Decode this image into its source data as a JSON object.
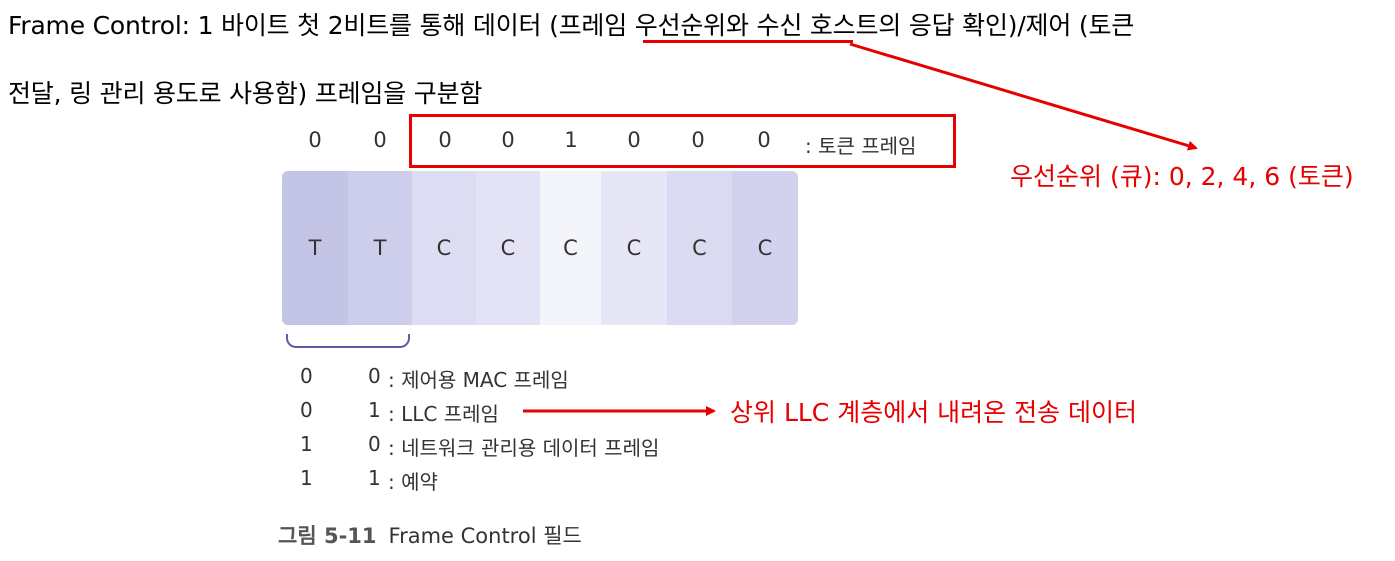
{
  "intro": {
    "line1_prefix": "Frame Control: 1 바이트 첫 2비트를 통해 데이터 (",
    "line1_highlight": "프레임 우선순위",
    "line1_suffix": "와 수신 호스트의 응답 확인)/제어 (토큰",
    "line2": "전달, 링 관리 용도로 사용함) 프레임을 구분함"
  },
  "bit_values": [
    "0",
    "0",
    "0",
    "0",
    "1",
    "0",
    "0",
    "0"
  ],
  "bits_suffix": ": 토큰 프레임",
  "priority_label": "우선순위 (큐): 0, 2, 4, 6 (토큰)",
  "fields": [
    {
      "label": "T",
      "color": "#c4c4e6"
    },
    {
      "label": "T",
      "color": "#cdcdec"
    },
    {
      "label": "C",
      "color": "#dcdcf2"
    },
    {
      "label": "C",
      "color": "#e3e3f5"
    },
    {
      "label": "C",
      "color": "#f4f4fb"
    },
    {
      "label": "C",
      "color": "#e6e6f6"
    },
    {
      "label": "C",
      "color": "#dadaf1"
    },
    {
      "label": "C",
      "color": "#d2d2ee"
    }
  ],
  "legend": [
    {
      "b1": "0",
      "b2": "0",
      "desc": ": 제어용 MAC 프레임"
    },
    {
      "b1": "0",
      "b2": "1",
      "desc": ": LLC 프레임"
    },
    {
      "b1": "1",
      "b2": "0",
      "desc": ": 네트워크 관리용 데이터 프레임"
    },
    {
      "b1": "1",
      "b2": "1",
      "desc": ": 예약"
    }
  ],
  "llc_note": "상위 LLC 계층에서 내려온 전송 데이터",
  "caption": {
    "number": "그림 5-11",
    "text": "Frame Control 필드"
  },
  "colors": {
    "annotation": "#e60000",
    "brace": "#5d5da8"
  }
}
